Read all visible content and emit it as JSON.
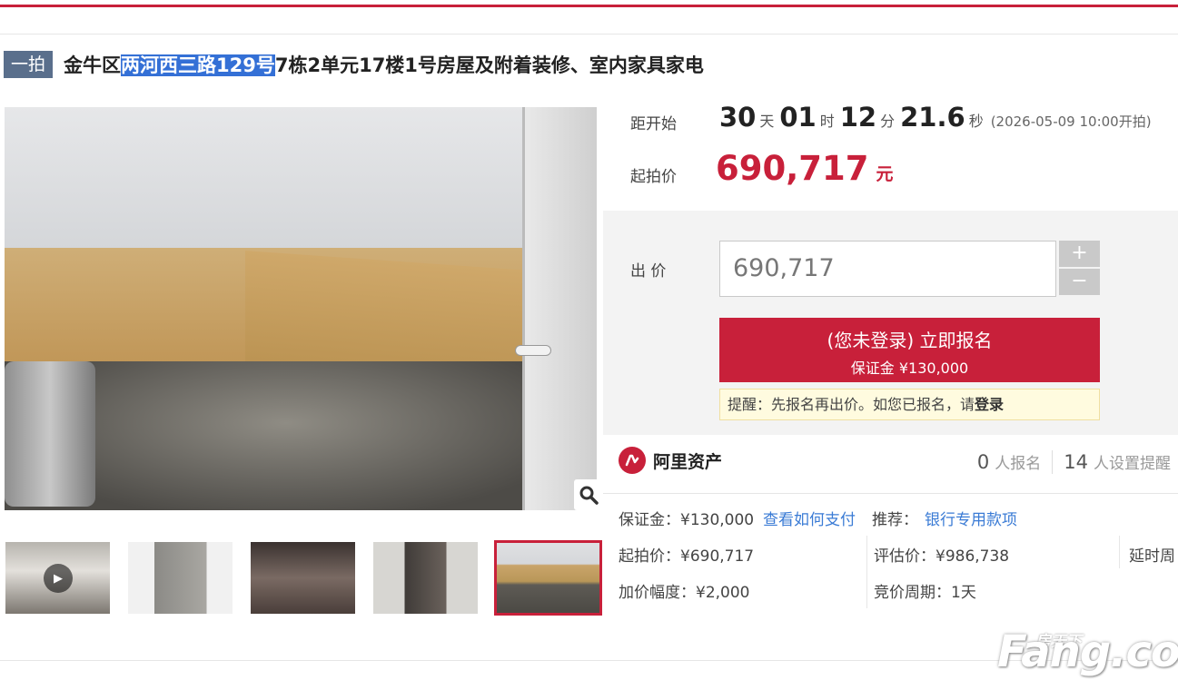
{
  "title": {
    "badge": "一拍",
    "prefix": "金牛区",
    "highlight": "两河西三路129号",
    "suffix": "7栋2单元17楼1号房屋及附着装修、室内家具家电"
  },
  "countdown": {
    "label": "距开始",
    "days": "30",
    "days_unit": "天",
    "hours": "01",
    "hours_unit": "时",
    "minutes": "12",
    "minutes_unit": "分",
    "seconds": "21.6",
    "seconds_unit": "秒",
    "start_text": "(2026-05-09 10:00开拍)"
  },
  "start_price": {
    "label": "起拍价",
    "value": "690,717",
    "unit": "元"
  },
  "bid": {
    "label": "出 价",
    "value": "690,717",
    "plus": "+",
    "minus": "−",
    "signup_line1": "(您未登录) 立即报名",
    "signup_line2": "保证金 ¥130,000",
    "tip_prefix": "提醒：先报名再出价。如您已报名，请",
    "tip_link": "登录"
  },
  "seller": {
    "logo_text": "ali",
    "name": "阿里资产",
    "signups": "0",
    "signups_label": "人报名",
    "reminders": "14",
    "reminders_label": "人设置提醒"
  },
  "details": {
    "deposit": "保证金：¥130,000",
    "how_to_pay": "查看如何支付",
    "recommend": "推荐：",
    "bank_fund": "银行专用款项",
    "start_price": "起拍价：¥690,717",
    "appraisal": "评估价：¥986,738",
    "delay": "延时周",
    "increment": "加价幅度：¥2,000",
    "cycle": "竞价周期：1天"
  },
  "watermark": {
    "small": "房天下",
    "big": "Fang.com"
  },
  "colors": {
    "accent": "#c8203a",
    "badge": "#5a6f8c",
    "link": "#3a7bd5"
  },
  "icons": {
    "zoom": "magnifier-icon",
    "play": "play-icon"
  }
}
